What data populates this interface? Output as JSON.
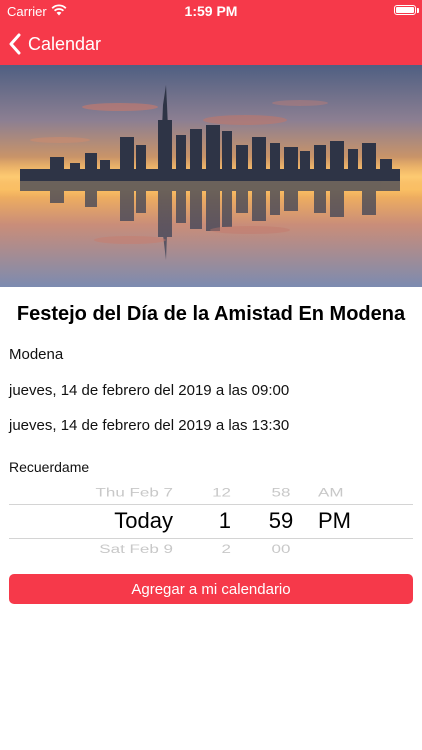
{
  "status_bar": {
    "carrier": "Carrier",
    "time": "1:59 PM"
  },
  "nav": {
    "back_label": "Calendar"
  },
  "colors": {
    "accent": "#f6394a"
  },
  "event": {
    "title": "Festejo del Día de la Amistad En Modena",
    "location": "Modena",
    "start": "jueves, 14 de febrero del 2019 a las 09:00",
    "end": "jueves, 14 de febrero del 2019 a las 13:30"
  },
  "reminder": {
    "label": "Recuerdame",
    "picker": {
      "date": [
        "Thu Feb 7",
        "Today",
        "Sat Feb 9"
      ],
      "hour": [
        "12",
        "1",
        "2"
      ],
      "minute": [
        "58",
        "59",
        "00"
      ],
      "ampm": [
        "AM",
        "PM",
        ""
      ]
    }
  },
  "actions": {
    "add_label": "Agregar a mi calendario"
  }
}
